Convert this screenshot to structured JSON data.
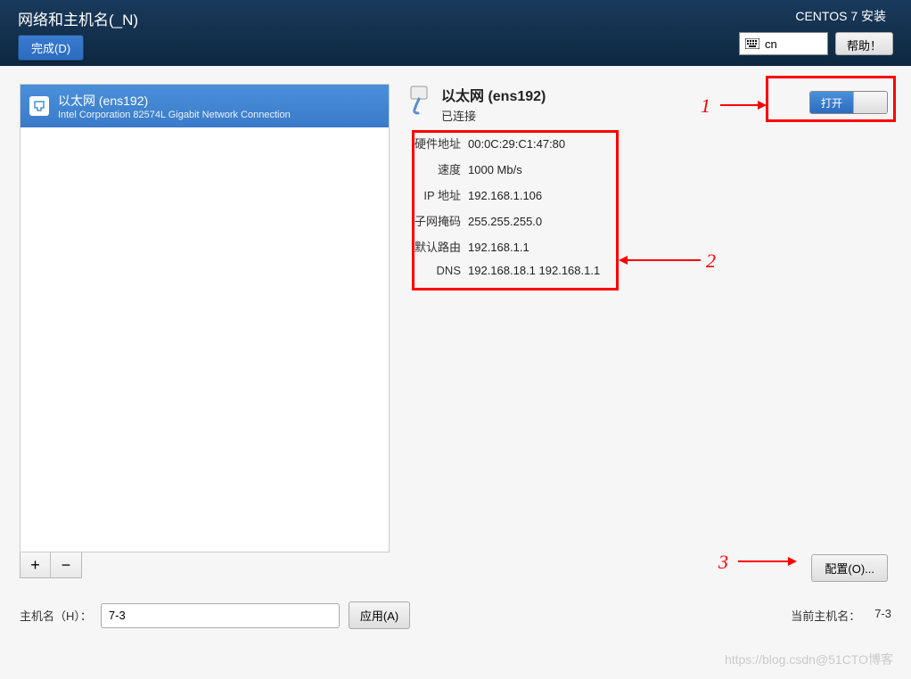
{
  "header": {
    "title": "网络和主机名(_N)",
    "done_label": "完成(D)",
    "install_title": "CENTOS 7 安装",
    "lang": "cn",
    "help_label": "帮助！"
  },
  "device_list": {
    "items": [
      {
        "name": "以太网 (ens192)",
        "desc": "Intel Corporation 82574L Gigabit Network Connection"
      }
    ],
    "add_label": "+",
    "remove_label": "−"
  },
  "connection": {
    "title": "以太网 (ens192)",
    "status": "已连接",
    "toggle_on_label": "打开",
    "details": [
      {
        "label": "硬件地址",
        "value": "00:0C:29:C1:47:80"
      },
      {
        "label": "速度",
        "value": "1000 Mb/s"
      },
      {
        "label": "IP 地址",
        "value": "192.168.1.106"
      },
      {
        "label": "子网掩码",
        "value": "255.255.255.0"
      },
      {
        "label": "默认路由",
        "value": "192.168.1.1"
      },
      {
        "label": "DNS",
        "value": "192.168.18.1 192.168.1.1"
      }
    ],
    "configure_label": "配置(O)..."
  },
  "hostname": {
    "label": "主机名（H）：",
    "value": "7-3",
    "apply_label": "应用(A)",
    "current_label": "当前主机名：",
    "current_value": "7-3"
  },
  "annotations": {
    "n1": "1",
    "n2": "2",
    "n3": "3"
  },
  "watermark": "https://blog.csdn@51CTO博客"
}
